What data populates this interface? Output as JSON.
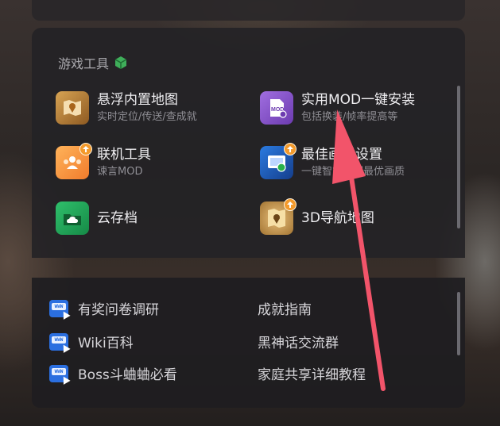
{
  "section": {
    "title": "游戏工具",
    "icon": "cube-icon"
  },
  "tools": [
    {
      "name": "悬浮内置地图",
      "desc": "实时定位/传送/查成就",
      "icon": "map-icon",
      "color": "#c58a3a"
    },
    {
      "name": "实用MOD一键安装",
      "desc": "包括换装/帧率提高等",
      "icon": "mod-icon",
      "color": "#8a55c9"
    },
    {
      "name": "联机工具",
      "desc": "谏言MOD",
      "icon": "multiplayer-icon",
      "color": "#f4973a"
    },
    {
      "name": "最佳画质设置",
      "desc": "一键智能匹配最优画质",
      "icon": "display-settings-icon",
      "color": "#1f5fbf"
    },
    {
      "name": "云存档",
      "desc": "",
      "icon": "cloud-save-icon",
      "color": "#1f9d55"
    },
    {
      "name": "3D导航地图",
      "desc": "",
      "icon": "3d-map-icon",
      "color": "#c99a4e"
    }
  ],
  "links_left": [
    {
      "label": "有奖问卷调研"
    },
    {
      "label": "Wiki百科"
    },
    {
      "label": "Boss斗蛐蛐必看"
    }
  ],
  "links_right": [
    {
      "label": "成就指南"
    },
    {
      "label": "黑神话交流群"
    },
    {
      "label": "家庭共享详细教程"
    }
  ],
  "colors": {
    "accent_arrow": "#f2546a",
    "badge": "#f39a2c",
    "www_icon": "#2b6fe0"
  }
}
